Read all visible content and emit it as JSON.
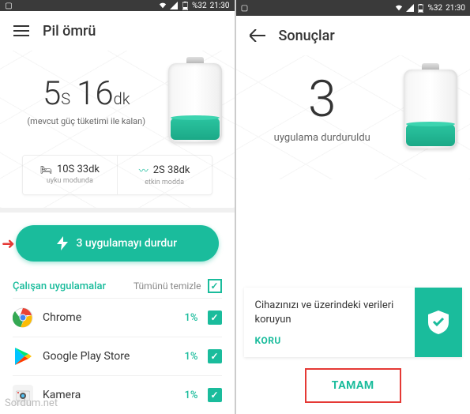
{
  "status": {
    "battery_pct": "%32",
    "time": "21:30"
  },
  "left": {
    "title": "Pil ömrü",
    "time_hours": "5",
    "hours_unit": "S",
    "time_mins": "16",
    "mins_unit": "dk",
    "subtitle": "(mevcut güç tüketimi ile kalan)",
    "sleep_value": "10S 33dk",
    "sleep_label": "uyku modunda",
    "active_value": "2S 38dk",
    "active_label": "etkin modda",
    "action_label": "3 uygulamayı durdur",
    "running_title": "Çalışan uygulamalar",
    "clear_all": "Tümünü temizle",
    "apps": [
      {
        "name": "Chrome",
        "pct": "1%"
      },
      {
        "name": "Google Play Store",
        "pct": "1%"
      },
      {
        "name": "Kamera",
        "pct": "1%"
      }
    ]
  },
  "right": {
    "title": "Sonuçlar",
    "big_number": "3",
    "subtitle": "uygulama durduruldu",
    "protect_msg": "Cihazınızı ve üzerindeki verileri koruyun",
    "protect_action": "KORU",
    "done_label": "TAMAM"
  },
  "watermark": "Sordum.net"
}
